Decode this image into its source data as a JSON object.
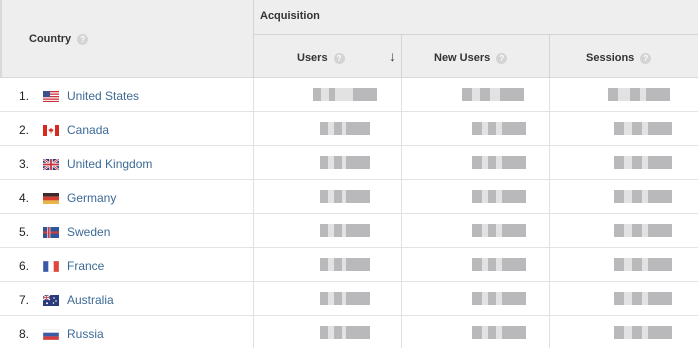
{
  "table": {
    "country_header": "Country",
    "help_glyph": "?",
    "group_header": "Acquisition",
    "columns": [
      {
        "label": "Users",
        "sorted": "descending"
      },
      {
        "label": "New Users"
      },
      {
        "label": "Sessions"
      }
    ],
    "sort_glyph": "↓",
    "rows": [
      {
        "rank": "1.",
        "country": "United States",
        "flag": "us-flag-icon"
      },
      {
        "rank": "2.",
        "country": "Canada",
        "flag": "ca-flag-icon"
      },
      {
        "rank": "3.",
        "country": "United Kingdom",
        "flag": "gb-flag-icon"
      },
      {
        "rank": "4.",
        "country": "Germany",
        "flag": "de-flag-icon"
      },
      {
        "rank": "5.",
        "country": "Sweden",
        "flag": "se-flag-icon"
      },
      {
        "rank": "6.",
        "country": "France",
        "flag": "fr-flag-icon"
      },
      {
        "rank": "7.",
        "country": "Australia",
        "flag": "au-flag-icon"
      },
      {
        "rank": "8.",
        "country": "Russia",
        "flag": "ru-flag-icon"
      }
    ]
  },
  "colors": {
    "header_bg": "#eeeeee",
    "link": "#3d6a96",
    "blur_dark": "#b9b9bb",
    "blur_light": "#e2e2e2"
  }
}
